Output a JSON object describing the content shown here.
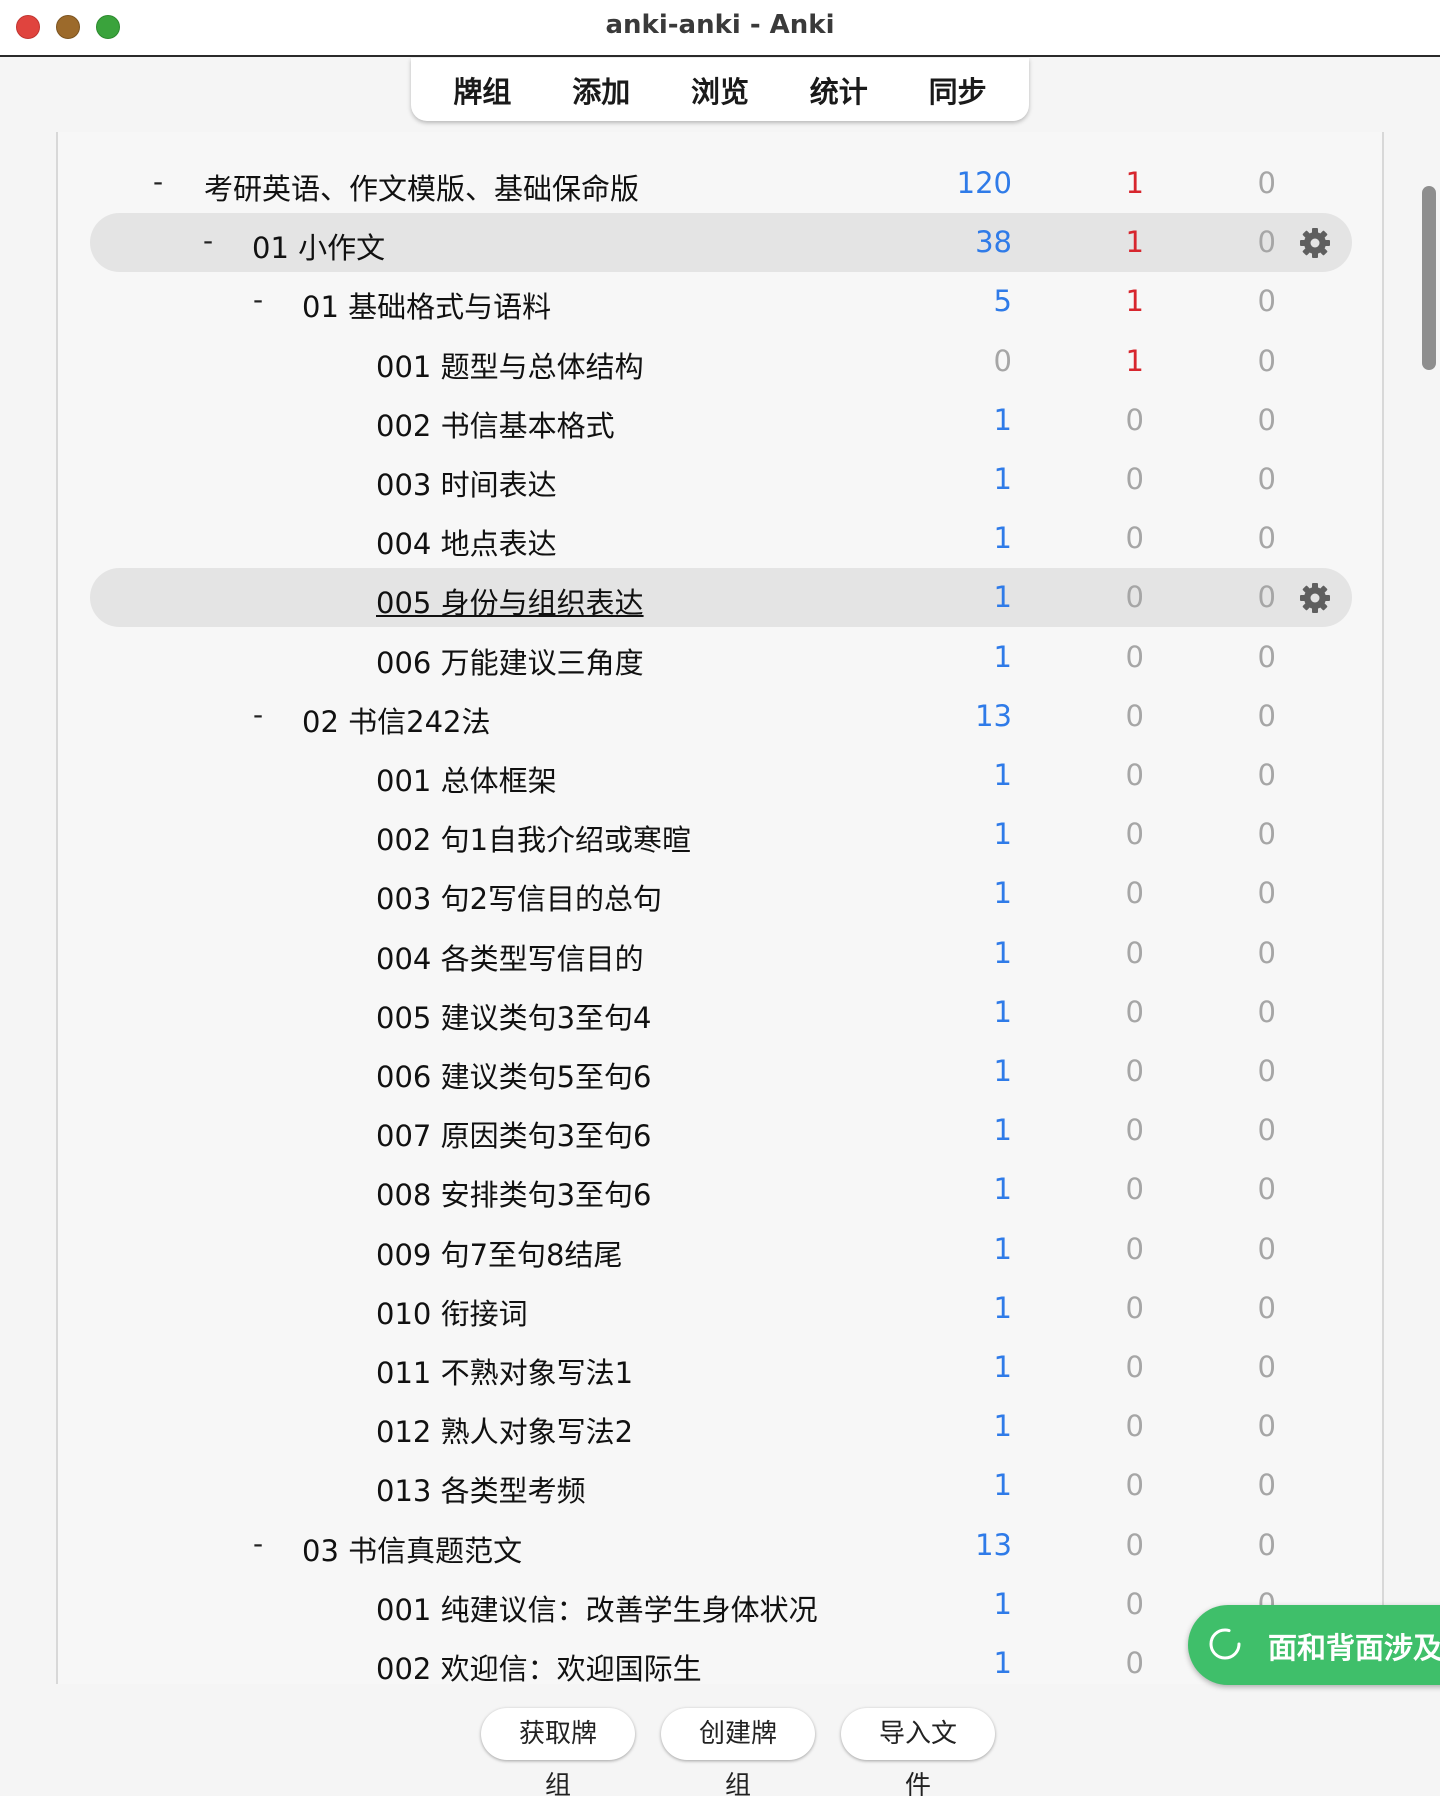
{
  "window": {
    "title": "anki-anki - Anki"
  },
  "toolbar": {
    "items": [
      "牌组",
      "添加",
      "浏览",
      "统计",
      "同步"
    ]
  },
  "decks": [
    {
      "collapse": "-",
      "name": "考研英语、作文模版、基础保命版",
      "level": 0,
      "new": "120",
      "learn": "1",
      "review": "0",
      "new_color": "blue",
      "learn_color": "red",
      "review_color": "gray",
      "highlight": false,
      "gear": false
    },
    {
      "collapse": "-",
      "name": "01 小作文",
      "level": 1,
      "new": "38",
      "learn": "1",
      "review": "0",
      "new_color": "blue",
      "learn_color": "red",
      "review_color": "gray",
      "highlight": true,
      "gear": true
    },
    {
      "collapse": "-",
      "name": "01 基础格式与语料",
      "level": 2,
      "new": "5",
      "learn": "1",
      "review": "0",
      "new_color": "blue",
      "learn_color": "red",
      "review_color": "gray",
      "highlight": false,
      "gear": false
    },
    {
      "collapse": "",
      "name": "001 题型与总体结构",
      "level": 3,
      "new": "0",
      "learn": "1",
      "review": "0",
      "new_color": "gray",
      "learn_color": "red",
      "review_color": "gray",
      "highlight": false,
      "gear": false
    },
    {
      "collapse": "",
      "name": "002 书信基本格式",
      "level": 3,
      "new": "1",
      "learn": "0",
      "review": "0",
      "new_color": "blue",
      "learn_color": "gray",
      "review_color": "gray",
      "highlight": false,
      "gear": false
    },
    {
      "collapse": "",
      "name": "003 时间表达",
      "level": 3,
      "new": "1",
      "learn": "0",
      "review": "0",
      "new_color": "blue",
      "learn_color": "gray",
      "review_color": "gray",
      "highlight": false,
      "gear": false
    },
    {
      "collapse": "",
      "name": "004 地点表达",
      "level": 3,
      "new": "1",
      "learn": "0",
      "review": "0",
      "new_color": "blue",
      "learn_color": "gray",
      "review_color": "gray",
      "highlight": false,
      "gear": false
    },
    {
      "collapse": "",
      "name": "005 身份与组织表达",
      "level": 3,
      "new": "1",
      "learn": "0",
      "review": "0",
      "new_color": "blue",
      "learn_color": "gray",
      "review_color": "gray",
      "highlight": true,
      "gear": true,
      "current": true
    },
    {
      "collapse": "",
      "name": "006 万能建议三角度",
      "level": 3,
      "new": "1",
      "learn": "0",
      "review": "0",
      "new_color": "blue",
      "learn_color": "gray",
      "review_color": "gray",
      "highlight": false,
      "gear": false
    },
    {
      "collapse": "-",
      "name": "02 书信242法",
      "level": 2,
      "new": "13",
      "learn": "0",
      "review": "0",
      "new_color": "blue",
      "learn_color": "gray",
      "review_color": "gray",
      "highlight": false,
      "gear": false
    },
    {
      "collapse": "",
      "name": "001 总体框架",
      "level": 3,
      "new": "1",
      "learn": "0",
      "review": "0",
      "new_color": "blue",
      "learn_color": "gray",
      "review_color": "gray",
      "highlight": false,
      "gear": false
    },
    {
      "collapse": "",
      "name": "002 句1自我介绍或寒暄",
      "level": 3,
      "new": "1",
      "learn": "0",
      "review": "0",
      "new_color": "blue",
      "learn_color": "gray",
      "review_color": "gray",
      "highlight": false,
      "gear": false
    },
    {
      "collapse": "",
      "name": "003 句2写信目的总句",
      "level": 3,
      "new": "1",
      "learn": "0",
      "review": "0",
      "new_color": "blue",
      "learn_color": "gray",
      "review_color": "gray",
      "highlight": false,
      "gear": false
    },
    {
      "collapse": "",
      "name": "004 各类型写信目的",
      "level": 3,
      "new": "1",
      "learn": "0",
      "review": "0",
      "new_color": "blue",
      "learn_color": "gray",
      "review_color": "gray",
      "highlight": false,
      "gear": false
    },
    {
      "collapse": "",
      "name": "005 建议类句3至句4",
      "level": 3,
      "new": "1",
      "learn": "0",
      "review": "0",
      "new_color": "blue",
      "learn_color": "gray",
      "review_color": "gray",
      "highlight": false,
      "gear": false
    },
    {
      "collapse": "",
      "name": "006 建议类句5至句6",
      "level": 3,
      "new": "1",
      "learn": "0",
      "review": "0",
      "new_color": "blue",
      "learn_color": "gray",
      "review_color": "gray",
      "highlight": false,
      "gear": false
    },
    {
      "collapse": "",
      "name": "007 原因类句3至句6",
      "level": 3,
      "new": "1",
      "learn": "0",
      "review": "0",
      "new_color": "blue",
      "learn_color": "gray",
      "review_color": "gray",
      "highlight": false,
      "gear": false
    },
    {
      "collapse": "",
      "name": "008 安排类句3至句6",
      "level": 3,
      "new": "1",
      "learn": "0",
      "review": "0",
      "new_color": "blue",
      "learn_color": "gray",
      "review_color": "gray",
      "highlight": false,
      "gear": false
    },
    {
      "collapse": "",
      "name": "009 句7至句8结尾",
      "level": 3,
      "new": "1",
      "learn": "0",
      "review": "0",
      "new_color": "blue",
      "learn_color": "gray",
      "review_color": "gray",
      "highlight": false,
      "gear": false
    },
    {
      "collapse": "",
      "name": "010 衔接词",
      "level": 3,
      "new": "1",
      "learn": "0",
      "review": "0",
      "new_color": "blue",
      "learn_color": "gray",
      "review_color": "gray",
      "highlight": false,
      "gear": false
    },
    {
      "collapse": "",
      "name": "011 不熟对象写法1",
      "level": 3,
      "new": "1",
      "learn": "0",
      "review": "0",
      "new_color": "blue",
      "learn_color": "gray",
      "review_color": "gray",
      "highlight": false,
      "gear": false
    },
    {
      "collapse": "",
      "name": "012 熟人对象写法2",
      "level": 3,
      "new": "1",
      "learn": "0",
      "review": "0",
      "new_color": "blue",
      "learn_color": "gray",
      "review_color": "gray",
      "highlight": false,
      "gear": false
    },
    {
      "collapse": "",
      "name": "013 各类型考频",
      "level": 3,
      "new": "1",
      "learn": "0",
      "review": "0",
      "new_color": "blue",
      "learn_color": "gray",
      "review_color": "gray",
      "highlight": false,
      "gear": false
    },
    {
      "collapse": "-",
      "name": "03 书信真题范文",
      "level": 2,
      "new": "13",
      "learn": "0",
      "review": "0",
      "new_color": "blue",
      "learn_color": "gray",
      "review_color": "gray",
      "highlight": false,
      "gear": false
    },
    {
      "collapse": "",
      "name": "001 纯建议信：改善学生身体状况",
      "level": 3,
      "new": "1",
      "learn": "0",
      "review": "0",
      "new_color": "blue",
      "learn_color": "gray",
      "review_color": "gray",
      "highlight": false,
      "gear": false
    },
    {
      "collapse": "",
      "name": "002 欢迎信：欢迎国际生",
      "level": 3,
      "new": "1",
      "learn": "0",
      "review": "0",
      "new_color": "blue",
      "learn_color": "gray",
      "review_color": "gray",
      "highlight": false,
      "gear": false
    }
  ],
  "colors": {
    "blue": "#2f7be8",
    "red": "#d7262e",
    "gray": "#a6a6a6",
    "toast": "#3fbf6a"
  },
  "bottom_buttons": [
    "获取牌组",
    "创建牌组",
    "导入文件"
  ],
  "toast": {
    "text": "面和背面涉及年",
    "icon": "spinner-icon"
  }
}
